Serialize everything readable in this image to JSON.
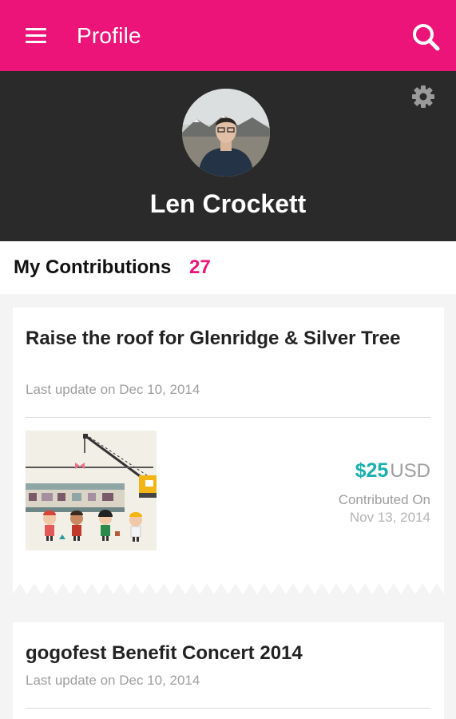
{
  "appbar": {
    "title": "Profile",
    "menu_icon": "hamburger-menu-icon",
    "search_icon": "search-icon",
    "color": "#ec1479"
  },
  "profile": {
    "name": "Len Crockett",
    "settings_icon": "gear-icon",
    "header_color": "#2a2a2a"
  },
  "contributions": {
    "label": "My Contributions",
    "count": "27",
    "items": [
      {
        "title": "Raise the roof for Glenridge & Silver Tree",
        "updated": "Last update on Dec 10, 2014",
        "amount": "$25",
        "currency": "USD",
        "contributed_label": "Contributed On",
        "contributed_date": "Nov 13, 2014"
      },
      {
        "title": "gogofest Benefit Concert 2014",
        "updated": "Last update on Dec 10, 2014"
      }
    ]
  },
  "colors": {
    "accent": "#ec1479",
    "amount": "#1bb0ae"
  }
}
